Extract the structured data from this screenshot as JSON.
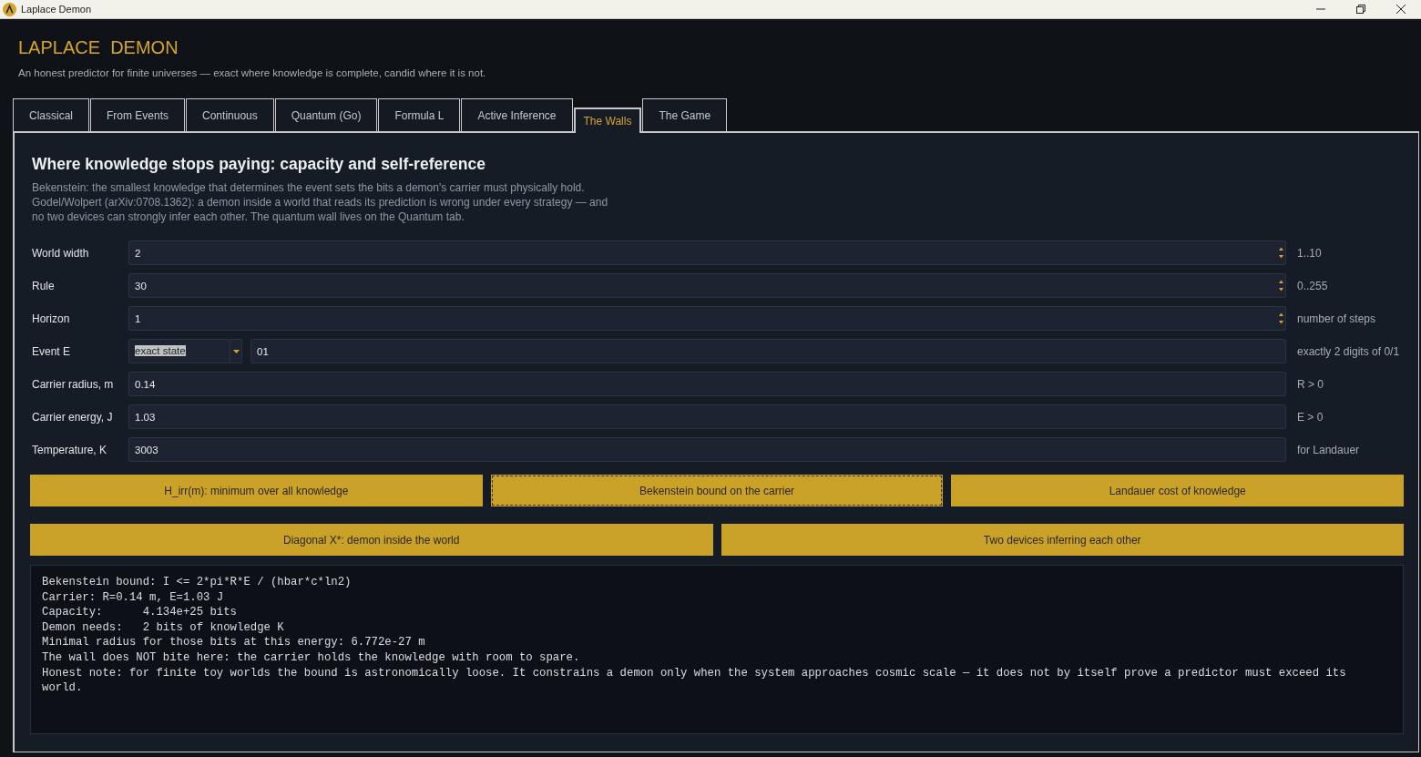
{
  "window": {
    "title": "Laplace Demon"
  },
  "header": {
    "title": "LAPLACE  DEMON",
    "subtitle": "An honest predictor for finite universes — exact where knowledge is complete, candid where it is not."
  },
  "tabs": [
    {
      "label": "Classical",
      "selected": false
    },
    {
      "label": "From Events",
      "selected": false
    },
    {
      "label": "Continuous",
      "selected": false
    },
    {
      "label": "Quantum (Go)",
      "selected": false
    },
    {
      "label": "Formula L",
      "selected": false
    },
    {
      "label": "Active Inference",
      "selected": false
    },
    {
      "label": "The Walls",
      "selected": true
    },
    {
      "label": "The Game",
      "selected": false
    }
  ],
  "panel": {
    "heading": "Where knowledge stops paying: capacity and self-reference",
    "description": "Bekenstein: the smallest knowledge that determines the event sets the bits a demon's carrier must physically hold. Godel/Wolpert (arXiv:0708.1362): a demon inside a world that reads its prediction is wrong under every strategy — and no two devices can strongly infer each other. The quantum wall lives on the Quantum tab."
  },
  "fields": [
    {
      "label": "World width",
      "kind": "spin",
      "value": "2",
      "hint": "1..10"
    },
    {
      "label": "Rule",
      "kind": "spin",
      "value": "30",
      "hint": "0..255"
    },
    {
      "label": "Horizon",
      "kind": "spin",
      "value": "1",
      "hint": "number of steps"
    },
    {
      "label": "Event E",
      "kind": "combo",
      "choice": "exact state",
      "highlighted": true,
      "value": "01",
      "hint": "exactly 2 digits of 0/1"
    },
    {
      "label": "Carrier radius, m",
      "kind": "text",
      "value": "0.14",
      "hint": "R > 0"
    },
    {
      "label": "Carrier energy, J",
      "kind": "text",
      "value": "1.03",
      "hint": "E > 0"
    },
    {
      "label": "Temperature, K",
      "kind": "text",
      "value": "3003",
      "hint": "for Landauer"
    }
  ],
  "button_rows": [
    {
      "buttons": [
        {
          "label": "H_irr(m): minimum over all knowledge",
          "focused": false
        },
        {
          "label": "Bekenstein bound on the carrier",
          "focused": true
        },
        {
          "label": "Landauer cost of knowledge",
          "focused": false
        }
      ]
    },
    {
      "buttons": [
        {
          "label": "Diagonal X*: demon inside the world",
          "focused": false
        },
        {
          "label": "Two devices inferring each other",
          "focused": false
        }
      ]
    }
  ],
  "output": {
    "lines": [
      "Bekenstein bound: I <= 2*pi*R*E / (hbar*c*ln2)",
      "Carrier: R=0.14 m, E=1.03 J",
      "Capacity:      4.134e+25 bits",
      "Demon needs:   2 bits of knowledge K",
      "Minimal radius for those bits at this energy: 6.772e-27 m",
      "The wall does NOT bite here: the carrier holds the knowledge with room to spare.",
      "Honest note: for finite toy worlds the bound is astronomically loose. It constrains a demon only when the system approaches cosmic scale — it does not by itself prove a predictor must exceed its world."
    ]
  }
}
